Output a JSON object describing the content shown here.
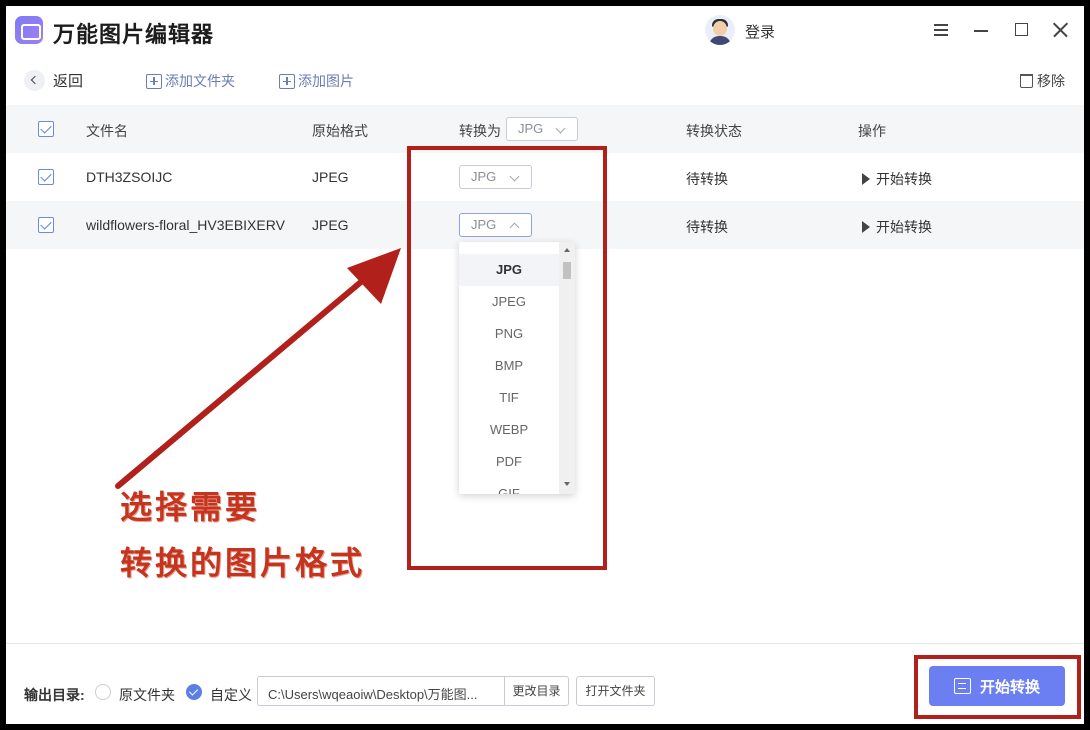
{
  "app": {
    "title": "万能图片编辑器",
    "login_label": "登录"
  },
  "toolbar": {
    "back_label": "返回",
    "add_folder_label": "添加文件夹",
    "add_image_label": "添加图片",
    "remove_label": "移除"
  },
  "table": {
    "headers": {
      "filename": "文件名",
      "original_format": "原始格式",
      "convert_to": "转换为",
      "status": "转换状态",
      "action": "操作"
    },
    "global_format": "JPG",
    "rows": [
      {
        "filename": "DTH3ZSOIJC",
        "original_format": "JPEG",
        "target_format": "JPG",
        "status": "待转换",
        "action": "开始转换",
        "checked": true
      },
      {
        "filename": "wildflowers-floral_HV3EBIXERV",
        "original_format": "JPEG",
        "target_format": "JPG",
        "status": "待转换",
        "action": "开始转换",
        "checked": true
      }
    ]
  },
  "dropdown": {
    "options": [
      "JPG",
      "JPEG",
      "PNG",
      "BMP",
      "TIF",
      "WEBP",
      "PDF",
      "GIF"
    ],
    "selected": "JPG"
  },
  "annotation": {
    "line1": "选择需要",
    "line2": "转换的图片格式",
    "color": "#b1201b"
  },
  "footer": {
    "output_label": "输出目录:",
    "radio_original": "原文件夹",
    "radio_custom": "自定义",
    "path": "C:\\Users\\wqeaoiw\\Desktop\\万能图...",
    "change_dir_label": "更改目录",
    "open_folder_label": "打开文件夹",
    "start_label": "开始转换"
  },
  "colors": {
    "accent": "#6b7ef2",
    "check": "#5a7be0",
    "toolbar_link": "#6a7db5"
  }
}
